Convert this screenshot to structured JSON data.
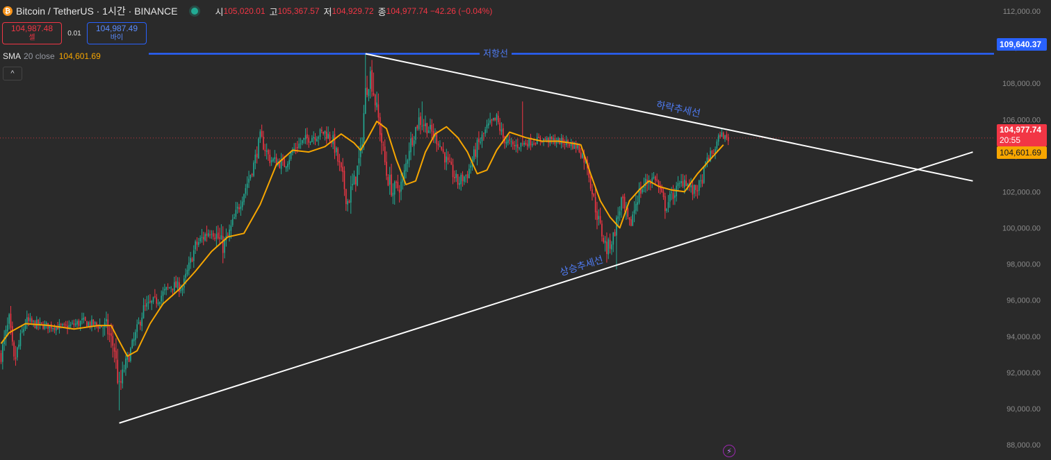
{
  "header": {
    "coin_glyph": "₿",
    "symbol_title": "Bitcoin / TetherUS · 1시간 · BINANCE",
    "ohlc": [
      {
        "key": "시",
        "value": "105,020.01"
      },
      {
        "key": "고",
        "value": "105,367.57"
      },
      {
        "key": "저",
        "value": "104,929.72"
      },
      {
        "key": "종",
        "value": "104,977.74 −42.26 (−0.04%)"
      }
    ]
  },
  "trade": {
    "sell_price": "104,987.48",
    "sell_label": "셀",
    "spread": "0.01",
    "buy_price": "104,987.49",
    "buy_label": "바이"
  },
  "indicator": {
    "name": "SMA",
    "params": "20 close",
    "value": "104,601.69",
    "collapse_glyph": "^"
  },
  "price_tags": {
    "resistance": "109,640.37",
    "last_price": "104,977.74",
    "countdown": "20:55",
    "sma": "104,601.69"
  },
  "flash_glyph": "⚡",
  "colors": {
    "background": "#2a2a2a",
    "up": "#22ab94",
    "down": "#f23645",
    "sma": "#f7a600",
    "resistance": "#2962ff",
    "trendline": "#ffffff",
    "annotation": "#4f7cf5",
    "axis_text": "#8a8a8a"
  },
  "chart_data": {
    "type": "candlestick",
    "timeframe": "1시간",
    "ylim": [
      87500,
      112500
    ],
    "y_ticks": [
      {
        "value": 88000,
        "label": "88,000.00"
      },
      {
        "value": 90000,
        "label": "90,000.00"
      },
      {
        "value": 92000,
        "label": "92,000.00"
      },
      {
        "value": 94000,
        "label": "94,000.00"
      },
      {
        "value": 96000,
        "label": "96,000.00"
      },
      {
        "value": 98000,
        "label": "98,000.00"
      },
      {
        "value": 100000,
        "label": "100,000.00"
      },
      {
        "value": 102000,
        "label": "102,000.00"
      },
      {
        "value": 104000,
        "label": "104,000.00"
      },
      {
        "value": 106000,
        "label": "106,000.00"
      },
      {
        "value": 108000,
        "label": "108,000.00"
      },
      {
        "value": 110000,
        "label": "110,000.00"
      },
      {
        "value": 112000,
        "label": "112,000.00"
      }
    ],
    "total_bars": 350,
    "candles": [
      {
        "i": 0,
        "c": 93000,
        "sw": 1200
      },
      {
        "i": 5,
        "c": 94800,
        "sw": 1400
      },
      {
        "i": 8,
        "c": 92500,
        "sw": 1600
      },
      {
        "i": 15,
        "c": 94800,
        "sw": 1000
      },
      {
        "i": 25,
        "c": 94600,
        "sw": 600
      },
      {
        "i": 40,
        "c": 94500,
        "sw": 600
      },
      {
        "i": 50,
        "c": 94800,
        "sw": 800
      },
      {
        "i": 60,
        "c": 94600,
        "sw": 700
      },
      {
        "i": 65,
        "c": 94500,
        "sw": 1400
      },
      {
        "i": 70,
        "c": 93300,
        "sw": 1500
      },
      {
        "i": 73,
        "c": 91000,
        "sw": 1800
      },
      {
        "i": 76,
        "c": 92200,
        "sw": 1200
      },
      {
        "i": 80,
        "c": 93200,
        "sw": 1000
      },
      {
        "i": 88,
        "c": 95500,
        "sw": 1000
      },
      {
        "i": 96,
        "c": 96000,
        "sw": 900
      },
      {
        "i": 105,
        "c": 96800,
        "sw": 900
      },
      {
        "i": 112,
        "c": 96700,
        "sw": 800
      },
      {
        "i": 120,
        "c": 99000,
        "sw": 1000
      },
      {
        "i": 130,
        "c": 100000,
        "sw": 1200
      },
      {
        "i": 137,
        "c": 99000,
        "sw": 1400
      },
      {
        "i": 140,
        "c": 99500,
        "sw": 1000
      },
      {
        "i": 148,
        "c": 101500,
        "sw": 1000
      },
      {
        "i": 156,
        "c": 103500,
        "sw": 1000
      },
      {
        "i": 160,
        "c": 105000,
        "sw": 1000
      },
      {
        "i": 166,
        "c": 103800,
        "sw": 900
      },
      {
        "i": 175,
        "c": 103500,
        "sw": 900
      },
      {
        "i": 182,
        "c": 104500,
        "sw": 800
      },
      {
        "i": 190,
        "c": 105000,
        "sw": 900
      },
      {
        "i": 200,
        "c": 105300,
        "sw": 900
      },
      {
        "i": 205,
        "c": 104800,
        "sw": 1000
      },
      {
        "i": 210,
        "c": 103000,
        "sw": 1400
      },
      {
        "i": 214,
        "c": 101500,
        "sw": 1700
      },
      {
        "i": 218,
        "c": 102500,
        "sw": 1500
      },
      {
        "i": 222,
        "c": 104000,
        "sw": 1800
      },
      {
        "i": 225,
        "c": 107500,
        "sw": 1500
      },
      {
        "i": 228,
        "c": 108500,
        "sw": 1400
      },
      {
        "i": 233,
        "c": 106000,
        "sw": 1500
      },
      {
        "i": 238,
        "c": 103000,
        "sw": 1500
      },
      {
        "i": 242,
        "c": 102000,
        "sw": 1500
      },
      {
        "i": 248,
        "c": 102500,
        "sw": 1200
      },
      {
        "i": 252,
        "c": 104500,
        "sw": 1200
      },
      {
        "i": 258,
        "c": 106000,
        "sw": 1200
      },
      {
        "i": 264,
        "c": 105500,
        "sw": 1000
      },
      {
        "i": 270,
        "c": 104800,
        "sw": 1000
      },
      {
        "i": 276,
        "c": 103500,
        "sw": 1000
      },
      {
        "i": 282,
        "c": 102500,
        "sw": 1000
      },
      {
        "i": 288,
        "c": 103000,
        "sw": 1000
      },
      {
        "i": 294,
        "c": 104500,
        "sw": 1100
      },
      {
        "i": 300,
        "c": 105500,
        "sw": 1000
      },
      {
        "i": 306,
        "c": 106000,
        "sw": 1100
      },
      {
        "i": 310,
        "c": 105000,
        "sw": 900
      },
      {
        "i": 316,
        "c": 104500,
        "sw": 800
      },
      {
        "i": 324,
        "c": 104700,
        "sw": 600
      },
      {
        "i": 334,
        "c": 104900,
        "sw": 600
      },
      {
        "i": 344,
        "c": 104800,
        "sw": 600
      },
      {
        "i": 350,
        "c": 104700,
        "sw": 600
      },
      {
        "i": 356,
        "c": 104500,
        "sw": 800
      },
      {
        "i": 362,
        "c": 103500,
        "sw": 1000
      },
      {
        "i": 366,
        "c": 101500,
        "sw": 1200
      },
      {
        "i": 370,
        "c": 100000,
        "sw": 1200
      },
      {
        "i": 374,
        "c": 98800,
        "sw": 1200
      },
      {
        "i": 378,
        "c": 99500,
        "sw": 1200
      },
      {
        "i": 383,
        "c": 101500,
        "sw": 1300
      },
      {
        "i": 388,
        "c": 100000,
        "sw": 1400
      },
      {
        "i": 393,
        "c": 101800,
        "sw": 1300
      },
      {
        "i": 398,
        "c": 102500,
        "sw": 1000
      },
      {
        "i": 404,
        "c": 102800,
        "sw": 900
      },
      {
        "i": 410,
        "c": 101200,
        "sw": 1100
      },
      {
        "i": 416,
        "c": 102000,
        "sw": 1000
      },
      {
        "i": 422,
        "c": 102700,
        "sw": 900
      },
      {
        "i": 427,
        "c": 102000,
        "sw": 900
      },
      {
        "i": 432,
        "c": 102400,
        "sw": 900
      },
      {
        "i": 436,
        "c": 103800,
        "sw": 900
      },
      {
        "i": 440,
        "c": 104200,
        "sw": 700
      },
      {
        "i": 444,
        "c": 105200,
        "sw": 600
      },
      {
        "i": 449,
        "c": 104900,
        "sw": 500
      }
    ],
    "candle_highlights": [
      {
        "i": 73,
        "low": 89900
      },
      {
        "i": 225,
        "high": 109640
      },
      {
        "i": 230,
        "high": 108600
      },
      {
        "i": 260,
        "high": 107000
      },
      {
        "i": 322,
        "high": 107000
      },
      {
        "i": 380,
        "low": 97700
      }
    ],
    "series": [
      {
        "name": "SMA 20 close",
        "points": [
          [
            0,
            93600
          ],
          [
            5,
            94200
          ],
          [
            15,
            94700
          ],
          [
            30,
            94600
          ],
          [
            45,
            94400
          ],
          [
            60,
            94600
          ],
          [
            68,
            94600
          ],
          [
            72,
            93900
          ],
          [
            78,
            92900
          ],
          [
            84,
            93200
          ],
          [
            92,
            94700
          ],
          [
            100,
            95800
          ],
          [
            110,
            96600
          ],
          [
            120,
            97600
          ],
          [
            130,
            98700
          ],
          [
            140,
            99500
          ],
          [
            150,
            99700
          ],
          [
            160,
            101300
          ],
          [
            170,
            103500
          ],
          [
            180,
            104300
          ],
          [
            190,
            104200
          ],
          [
            200,
            104500
          ],
          [
            210,
            105200
          ],
          [
            218,
            104700
          ],
          [
            222,
            104300
          ],
          [
            226,
            104900
          ],
          [
            232,
            105900
          ],
          [
            238,
            105500
          ],
          [
            244,
            103800
          ],
          [
            250,
            102400
          ],
          [
            256,
            102600
          ],
          [
            262,
            104200
          ],
          [
            268,
            105200
          ],
          [
            275,
            105600
          ],
          [
            282,
            105000
          ],
          [
            288,
            104200
          ],
          [
            294,
            103000
          ],
          [
            300,
            103200
          ],
          [
            306,
            104300
          ],
          [
            314,
            105300
          ],
          [
            324,
            105000
          ],
          [
            334,
            104800
          ],
          [
            344,
            104800
          ],
          [
            352,
            104700
          ],
          [
            358,
            104600
          ],
          [
            364,
            103000
          ],
          [
            370,
            101500
          ],
          [
            376,
            100600
          ],
          [
            382,
            100000
          ],
          [
            388,
            101500
          ],
          [
            394,
            102100
          ],
          [
            400,
            102600
          ],
          [
            406,
            102300
          ],
          [
            414,
            102100
          ],
          [
            422,
            102000
          ],
          [
            430,
            103000
          ],
          [
            438,
            103800
          ],
          [
            446,
            104600
          ]
        ]
      }
    ],
    "horizontal_lines": [
      {
        "name": "resistance",
        "price": 109640.37,
        "label": "저항선"
      }
    ],
    "trendlines": [
      {
        "name": "falling",
        "label": "하락추세선",
        "from": {
          "i": 225,
          "price": 109640
        },
        "to": {
          "i": 600,
          "price": 102600
        }
      },
      {
        "name": "rising",
        "label": "상승추세선",
        "from": {
          "i": 73,
          "price": 89200
        },
        "to": {
          "i": 600,
          "price": 104200
        }
      }
    ],
    "last_price": 104977.74
  }
}
